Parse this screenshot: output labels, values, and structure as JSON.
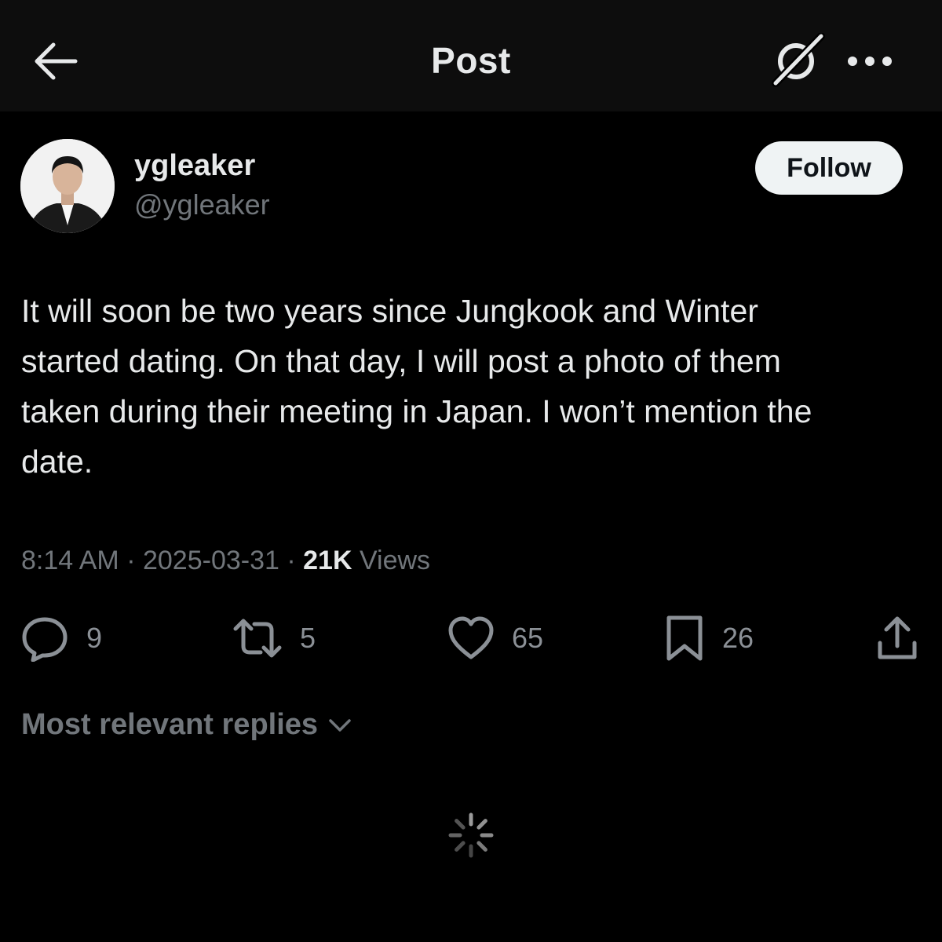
{
  "header": {
    "title": "Post",
    "icons": {
      "back": "arrow-left-icon",
      "grok": "grok-icon",
      "more": "more-dots-icon"
    }
  },
  "post": {
    "author": {
      "display_name": "ygleaker",
      "handle": "@ygleaker"
    },
    "follow_label": "Follow",
    "text_lines": [
      "It will soon be two years since Jungkook and Winter",
      "started dating. On that day, I will post a photo of them",
      "taken during their meeting in Japan. I won’t mention the",
      "date."
    ],
    "meta": {
      "time": "8:14 AM",
      "separator": "·",
      "date": "2025-03-31",
      "views_count": "21K",
      "views_label": "Views"
    },
    "actions": {
      "replies": "9",
      "reposts": "5",
      "likes": "65",
      "bookmarks": "26"
    }
  },
  "replies_sort": {
    "label": "Most relevant replies"
  },
  "colors": {
    "background": "#000000",
    "header_background": "#0d0d0d",
    "primary_text": "#e7e9ea",
    "secondary_text": "#71767b",
    "follow_button": "#eff3f4"
  }
}
